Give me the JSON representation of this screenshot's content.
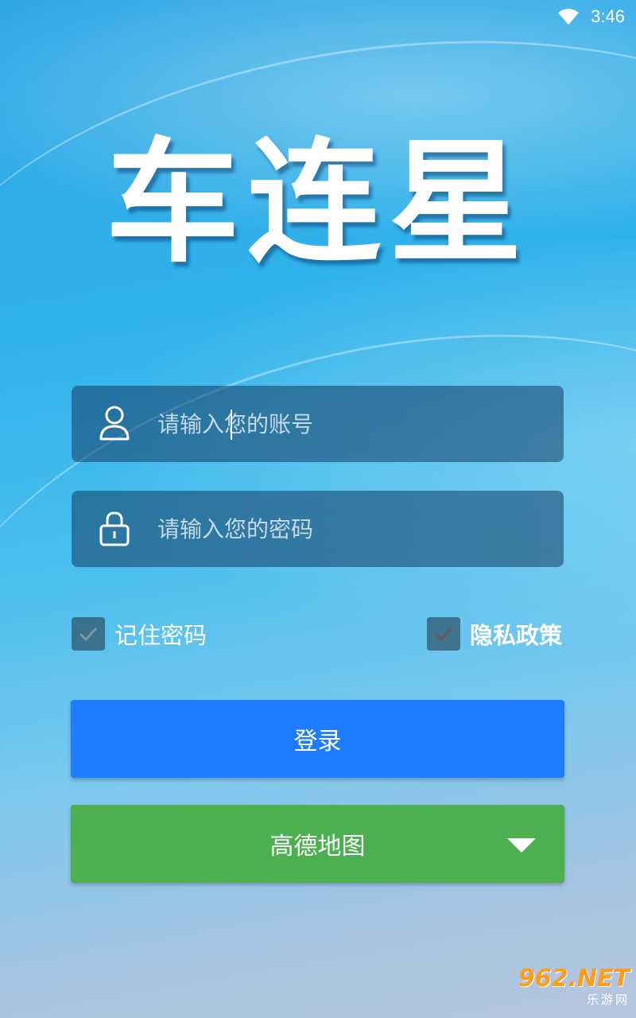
{
  "status_bar": {
    "time": "3:46",
    "wifi_icon": "wifi-icon"
  },
  "app": {
    "logo_text": "车连星"
  },
  "account_field": {
    "placeholder": "请输入您的账号",
    "value": "",
    "icon": "user-icon"
  },
  "password_field": {
    "placeholder": "请输入您的密码",
    "value": "",
    "icon": "lock-icon"
  },
  "options": {
    "remember_label": "记住密码",
    "remember_checked": true,
    "privacy_label": "隐私政策",
    "privacy_checked": true
  },
  "buttons": {
    "login_label": "登录",
    "map_label": "高德地图",
    "map_dropdown_icon": "triangle-down-icon"
  },
  "watermark": {
    "main": "962.NET",
    "sub": "乐游网"
  },
  "colors": {
    "login_button": "#1f7cff",
    "map_button": "#4caf50",
    "field_background": "rgba(20,60,100,0.55)",
    "text": "#ffffff"
  }
}
